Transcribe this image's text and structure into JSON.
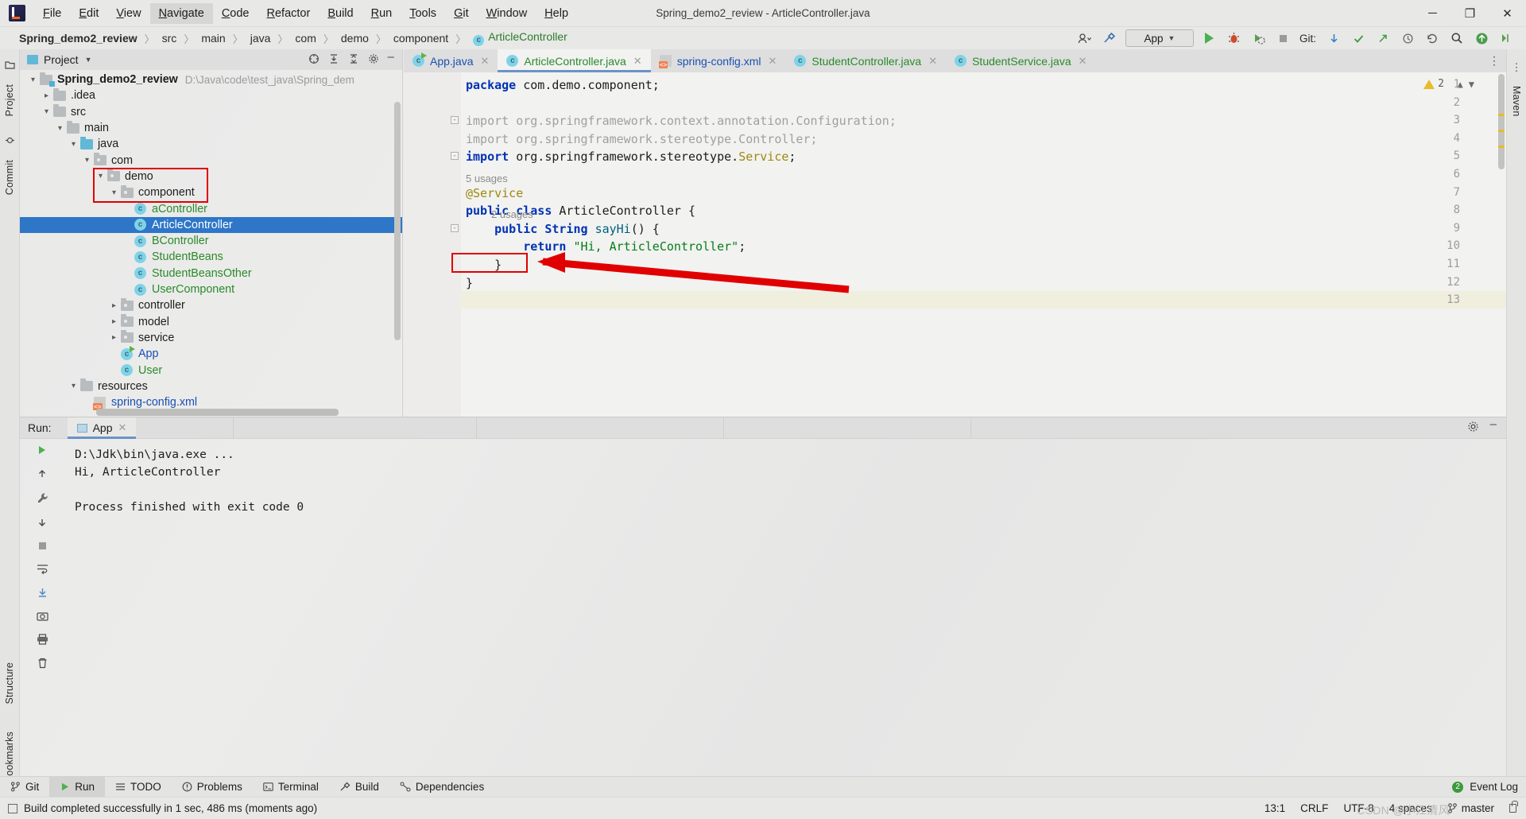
{
  "window": {
    "title": "Spring_demo2_review - ArticleController.java",
    "minimize": "─",
    "maximize": "❐",
    "close": "✕"
  },
  "menubar": {
    "items": [
      {
        "label": "File",
        "mnemonic": "F",
        "active": false
      },
      {
        "label": "Edit",
        "mnemonic": "E",
        "active": false
      },
      {
        "label": "View",
        "mnemonic": "V",
        "active": false
      },
      {
        "label": "Navigate",
        "mnemonic": "N",
        "active": true
      },
      {
        "label": "Code",
        "mnemonic": "C",
        "active": false
      },
      {
        "label": "Refactor",
        "mnemonic": "R",
        "active": false
      },
      {
        "label": "Build",
        "mnemonic": "B",
        "active": false
      },
      {
        "label": "Run",
        "mnemonic": "R",
        "active": false
      },
      {
        "label": "Tools",
        "mnemonic": "T",
        "active": false
      },
      {
        "label": "Git",
        "mnemonic": "G",
        "active": false
      },
      {
        "label": "Window",
        "mnemonic": "W",
        "active": false
      },
      {
        "label": "Help",
        "mnemonic": "H",
        "active": false
      }
    ]
  },
  "breadcrumb": {
    "items": [
      "Spring_demo2_review",
      "src",
      "main",
      "java",
      "com",
      "demo",
      "component",
      "ArticleController"
    ],
    "separator": "〉"
  },
  "toolbar": {
    "run_config": "App",
    "git_label": "Git:",
    "run_tooltip": "Run",
    "debug_tooltip": "Debug",
    "coverage_tooltip": "Run with Coverage",
    "stop_tooltip": "Stop",
    "search_tooltip": "Search Everywhere",
    "settings_tooltip": "Settings",
    "update_tooltip": "Update Project",
    "commit_tooltip": "Commit",
    "push_tooltip": "Push",
    "history_tooltip": "History",
    "rollback_tooltip": "Rollback"
  },
  "left_strip": {
    "project": "Project",
    "commit": "Commit",
    "structure": "Structure",
    "bookmarks": "Bookmarks"
  },
  "right_strip": {
    "maven": "Maven"
  },
  "project_panel": {
    "title": "Project",
    "scroll_h": true,
    "tree": [
      {
        "label": "Spring_demo2_review",
        "path": "D:\\Java\\code\\test_java\\Spring_dem",
        "indent": 0,
        "twist": "v",
        "icon": "folder-module",
        "style": "bold"
      },
      {
        "label": ".idea",
        "indent": 1,
        "twist": ">",
        "icon": "folder"
      },
      {
        "label": "src",
        "indent": 1,
        "twist": "v",
        "icon": "folder"
      },
      {
        "label": "main",
        "indent": 2,
        "twist": "v",
        "icon": "folder"
      },
      {
        "label": "java",
        "indent": 3,
        "twist": "v",
        "icon": "folder-src"
      },
      {
        "label": "com",
        "indent": 4,
        "twist": "v",
        "icon": "folder-pkg"
      },
      {
        "label": "demo",
        "indent": 5,
        "twist": "v",
        "icon": "folder-pkg"
      },
      {
        "label": "component",
        "indent": 6,
        "twist": "v",
        "icon": "folder-pkg"
      },
      {
        "label": "aController",
        "indent": 7,
        "twist": "",
        "icon": "class",
        "style": "green"
      },
      {
        "label": "ArticleController",
        "indent": 7,
        "twist": "",
        "icon": "class",
        "selected": true
      },
      {
        "label": "BController",
        "indent": 7,
        "twist": "",
        "icon": "class",
        "style": "green"
      },
      {
        "label": "StudentBeans",
        "indent": 7,
        "twist": "",
        "icon": "class",
        "style": "green"
      },
      {
        "label": "StudentBeansOther",
        "indent": 7,
        "twist": "",
        "icon": "class",
        "style": "green"
      },
      {
        "label": "UserComponent",
        "indent": 7,
        "twist": "",
        "icon": "class",
        "style": "green"
      },
      {
        "label": "controller",
        "indent": 6,
        "twist": ">",
        "icon": "folder-pkg"
      },
      {
        "label": "model",
        "indent": 6,
        "twist": ">",
        "icon": "folder-pkg"
      },
      {
        "label": "service",
        "indent": 6,
        "twist": ">",
        "icon": "folder-pkg"
      },
      {
        "label": "App",
        "indent": 6,
        "twist": "",
        "icon": "class-runnable",
        "style": "blue"
      },
      {
        "label": "User",
        "indent": 6,
        "twist": "",
        "icon": "class",
        "style": "green"
      },
      {
        "label": "resources",
        "indent": 3,
        "twist": "v",
        "icon": "folder-res"
      },
      {
        "label": "spring-config.xml",
        "indent": 4,
        "twist": "",
        "icon": "xml",
        "style": "blue"
      }
    ]
  },
  "editor": {
    "tabs": [
      {
        "label": "App.java",
        "icon": "class-runnable",
        "color": "blue",
        "active": false
      },
      {
        "label": "ArticleController.java",
        "icon": "class",
        "color": "green",
        "active": true
      },
      {
        "label": "spring-config.xml",
        "icon": "xml",
        "color": "blue",
        "active": false
      },
      {
        "label": "StudentController.java",
        "icon": "class",
        "color": "green",
        "active": false
      },
      {
        "label": "StudentService.java",
        "icon": "class",
        "color": "green",
        "active": false
      }
    ],
    "warning_count": "2",
    "line_numbers": [
      "1",
      "2",
      "3",
      "4",
      "5",
      "6",
      "7",
      "8",
      "9",
      "10",
      "11",
      "12",
      "13"
    ],
    "caret_line": 13,
    "usages": [
      {
        "text": "5 usages",
        "line": 7
      },
      {
        "text": "2 usages",
        "line": 9
      }
    ],
    "code": [
      {
        "line": 1,
        "tokens": [
          {
            "t": "package ",
            "c": "kw"
          },
          {
            "t": "com.demo.component;",
            "c": ""
          }
        ]
      },
      {
        "line": 2,
        "tokens": []
      },
      {
        "line": 3,
        "tokens": [
          {
            "t": "import ",
            "c": "kw-fade"
          },
          {
            "t": "org.springframework.context.annotation.Configuration;",
            "c": "fade"
          }
        ]
      },
      {
        "line": 4,
        "tokens": [
          {
            "t": "import ",
            "c": "kw-fade"
          },
          {
            "t": "org.springframework.stereotype.Controller;",
            "c": "fade"
          }
        ]
      },
      {
        "line": 5,
        "tokens": [
          {
            "t": "import ",
            "c": "kw"
          },
          {
            "t": "org.springframework.stereotype.",
            "c": ""
          },
          {
            "t": "Service",
            "c": "ann"
          },
          {
            "t": ";",
            "c": ""
          }
        ]
      },
      {
        "line": 6,
        "tokens": []
      },
      {
        "line": 7,
        "tokens": [
          {
            "t": "@Service",
            "c": "ann"
          }
        ]
      },
      {
        "line": 8,
        "tokens": [
          {
            "t": "public class ",
            "c": "kw"
          },
          {
            "t": "ArticleController {",
            "c": ""
          }
        ]
      },
      {
        "line": 9,
        "tokens": [
          {
            "t": "    public ",
            "c": "kw"
          },
          {
            "t": "String ",
            "c": "kw"
          },
          {
            "t": "sayHi",
            "c": "mth"
          },
          {
            "t": "() {",
            "c": ""
          }
        ]
      },
      {
        "line": 10,
        "tokens": [
          {
            "t": "        return ",
            "c": "kw"
          },
          {
            "t": "\"Hi, ArticleController\"",
            "c": "str"
          },
          {
            "t": ";",
            "c": ""
          }
        ]
      },
      {
        "line": 11,
        "tokens": [
          {
            "t": "    }",
            "c": ""
          }
        ]
      },
      {
        "line": 12,
        "tokens": [
          {
            "t": "}",
            "c": ""
          }
        ]
      },
      {
        "line": 13,
        "tokens": []
      }
    ]
  },
  "annotations": {
    "box_service": true,
    "box_tree": true,
    "arrow": true,
    "color": "#e00000"
  },
  "run_window": {
    "label": "Run:",
    "tab": "App",
    "console": [
      "D:\\Jdk\\bin\\java.exe ...",
      "Hi, ArticleController",
      "",
      "Process finished with exit code 0"
    ]
  },
  "bottom_bar": {
    "items": [
      {
        "label": "Git",
        "icon": "git-icon",
        "active": false
      },
      {
        "label": "Run",
        "icon": "run-icon",
        "active": true
      },
      {
        "label": "TODO",
        "icon": "todo-icon",
        "active": false
      },
      {
        "label": "Problems",
        "icon": "problems-icon",
        "active": false
      },
      {
        "label": "Terminal",
        "icon": "terminal-icon",
        "active": false
      },
      {
        "label": "Build",
        "icon": "build-icon",
        "active": false
      },
      {
        "label": "Dependencies",
        "icon": "dependencies-icon",
        "active": false
      }
    ],
    "event_log": "Event Log",
    "event_count": "2"
  },
  "status_bar": {
    "message": "Build completed successfully in 1 sec, 486 ms (moments ago)",
    "position": "13:1",
    "line_separator": "CRLF",
    "encoding": "UTF-8",
    "indent": "4 spaces",
    "branch": "master",
    "watermark": "CSDN @小江清风"
  }
}
